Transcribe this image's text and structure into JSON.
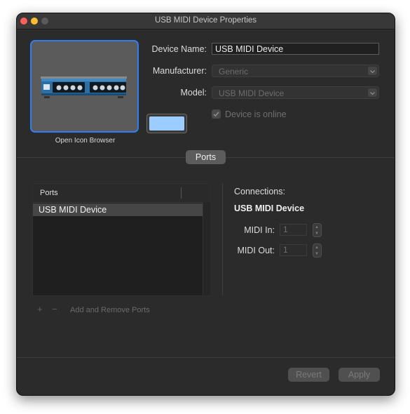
{
  "window": {
    "title": "USB MIDI Device Properties"
  },
  "icon_panel": {
    "caption": "Open Icon Browser",
    "swatch_color": "#9dcdff"
  },
  "form": {
    "device_name_label": "Device Name:",
    "device_name_value": "USB MIDI Device",
    "manufacturer_label": "Manufacturer:",
    "manufacturer_value": "Generic",
    "model_label": "Model:",
    "model_value": "USB MIDI Device",
    "online_label": "Device is online",
    "online_checked": true
  },
  "ports_tab_label": "Ports",
  "ports_table": {
    "header": "Ports",
    "rows": [
      "USB MIDI Device"
    ]
  },
  "add_remove": {
    "add_symbol": "+",
    "remove_symbol": "−",
    "label": "Add and Remove Ports"
  },
  "connections": {
    "title": "Connections:",
    "device": "USB MIDI Device",
    "midi_in_label": "MIDI In:",
    "midi_in_value": "1",
    "midi_out_label": "MIDI Out:",
    "midi_out_value": "1"
  },
  "footer": {
    "revert_label": "Revert",
    "apply_label": "Apply"
  }
}
